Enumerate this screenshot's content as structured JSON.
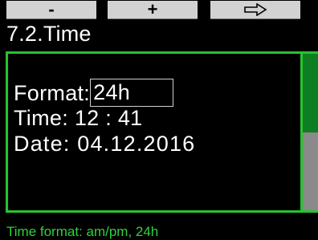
{
  "softkeys": {
    "left_label": "-",
    "middle_label": "+",
    "right_icon": "right-arrow-outline-icon"
  },
  "title": "7.2.Time",
  "settings": {
    "format_label": "Format:",
    "format_value": "24h",
    "time_label": "Time:",
    "time_value": "12 : 41",
    "date_label": "Date:",
    "date_value": "04.12.2016"
  },
  "hint": "Time format: am/pm, 24h",
  "colors": {
    "accent": "#27c32f",
    "softkey_bg": "#d2d2d2",
    "scroll_upper": "#0d7f22",
    "scroll_thumb": "#8a8a8a"
  }
}
